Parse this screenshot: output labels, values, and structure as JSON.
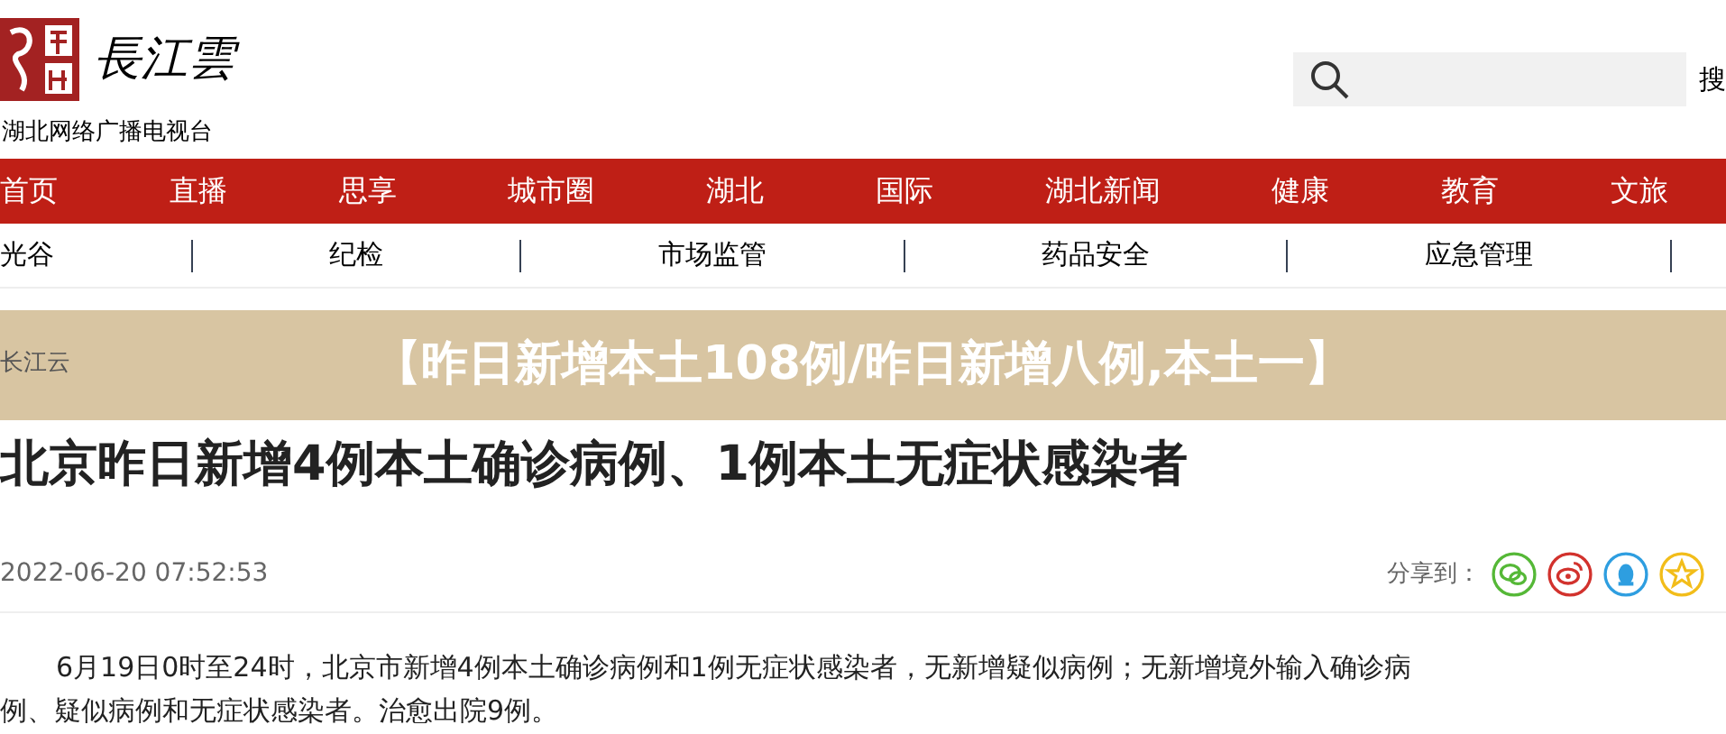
{
  "header": {
    "logo_text": "長江雲",
    "tagline": "湖北网络广播电视台",
    "search_button": "搜"
  },
  "nav": [
    {
      "label": "首页"
    },
    {
      "label": "直播"
    },
    {
      "label": "思享"
    },
    {
      "label": "城市圈"
    },
    {
      "label": "湖北"
    },
    {
      "label": "国际"
    },
    {
      "label": "湖北新闻"
    },
    {
      "label": "健康"
    },
    {
      "label": "教育"
    },
    {
      "label": "文旅"
    }
  ],
  "subnav": [
    {
      "label": "光谷"
    },
    {
      "label": "纪检"
    },
    {
      "label": "市场监管"
    },
    {
      "label": "药品安全"
    },
    {
      "label": "应急管理"
    }
  ],
  "banner": {
    "source": "长江云",
    "title": "【昨日新增本土108例/昨日新增八例,本土一】"
  },
  "article": {
    "headline": "北京昨日新增4例本土确诊病例、1例本土无症状感染者",
    "date": "2022-06-20 07:52:53",
    "share_label": "分享到：",
    "body_lines": [
      "6月19日0时至24时，北京市新增4例本土确诊病例和1例无症状感染者，无新增疑似病例；无新增境外输入确诊病",
      "例、疑似病例和无症状感染者。治愈出院9例。"
    ]
  }
}
